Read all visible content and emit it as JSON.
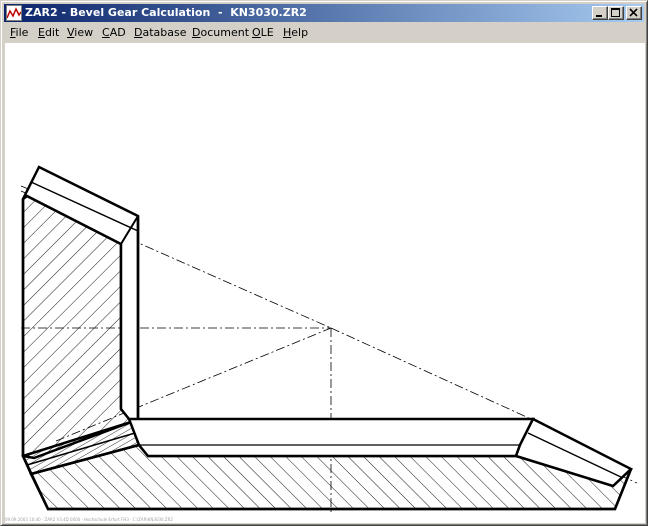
{
  "window": {
    "title": "ZAR2 - Bevel Gear Calculation  -  KN3030.ZR2",
    "icon": "zar2-app-icon",
    "caption_buttons": [
      "minimize",
      "maximize",
      "close"
    ]
  },
  "menu": {
    "items": [
      {
        "name": "file",
        "accel": "F",
        "rest": "ile"
      },
      {
        "name": "edit",
        "accel": "E",
        "rest": "dit"
      },
      {
        "name": "view",
        "accel": "V",
        "rest": "iew"
      },
      {
        "name": "cad",
        "accel": "C",
        "rest": "AD"
      },
      {
        "name": "database",
        "accel": "D",
        "rest": "atabase"
      },
      {
        "name": "document",
        "accel": "D",
        "rest": "ocument"
      },
      {
        "name": "ole",
        "accel": "O",
        "rest": "LE"
      },
      {
        "name": "help",
        "accel": "H",
        "rest": "elp"
      }
    ]
  },
  "drawing": {
    "line_color": "#000000",
    "background": "#ffffff"
  },
  "status": {
    "text": "09.09.2003 10:40 · ZAR2 V3.4D 0000 · Hochschule Erfurt FH3 · C:\\ZAR\\KN3030.ZR2"
  }
}
